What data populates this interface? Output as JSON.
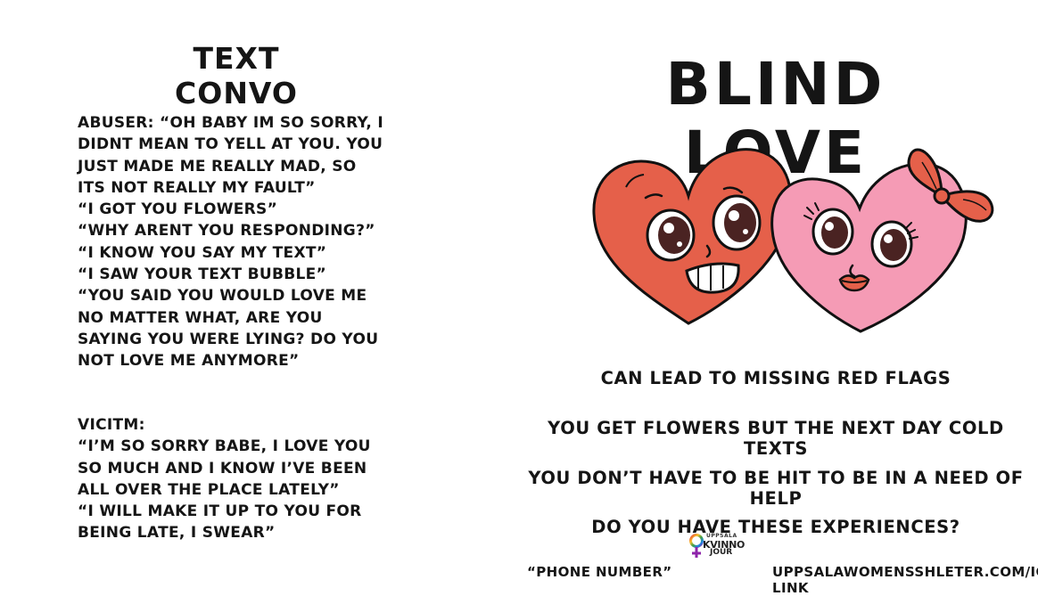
{
  "left_panel": {
    "title": "TEXT CONVO",
    "abuser": {
      "label_line": "ABUSER: “OH BABY IM SO SORRY, I DIDNT MEAN TO YELL AT YOU. YOU JUST MADE ME REALLY MAD, SO ITS NOT REALLY MY FAULT”",
      "lines": [
        "“I GOT YOU FLOWERS”",
        "“WHY ARENT YOU RESPONDING?”",
        "“I KNOW YOU SAY MY TEXT”",
        "“I SAW YOUR TEXT BUBBLE”",
        "“YOU SAID YOU WOULD LOVE ME NO MATTER WHAT, ARE YOU SAYING YOU WERE LYING? DO YOU NOT LOVE ME ANYMORE”"
      ]
    },
    "victim": {
      "label": "VICITM:",
      "lines": [
        "“I’M SO SORRY BABE, I LOVE YOU SO MUCH AND I KNOW I’VE BEEN ALL OVER THE PLACE LATELY”",
        "“I WILL MAKE IT UP TO YOU FOR BEING LATE, I SWEAR”"
      ]
    }
  },
  "right_panel": {
    "title": "BLIND LOVE",
    "messages": [
      "CAN LEAD TO MISSING RED FLAGS",
      "YOU GET FLOWERS BUT THE NEXT DAY COLD TEXTS",
      "YOU DON’T HAVE TO BE HIT TO BE IN A NEED OF HELP",
      "DO YOU HAVE THESE EXPERIENCES?"
    ],
    "logo": {
      "top": "UPPSALA",
      "line1": "KVINNO",
      "line2": "JOUR"
    },
    "footer": {
      "phone": "“PHONE NUMBER”",
      "link": "UPPSALAWOMENSSHLETER.COM/IG LINK"
    }
  },
  "colors": {
    "red_heart": "#e5604a",
    "pink_heart": "#f59bb5",
    "outline": "#111111",
    "bow": "#e5604a"
  },
  "icons": [
    "red-heart-character",
    "pink-heart-character",
    "bow-icon",
    "venus-symbol-icon"
  ]
}
